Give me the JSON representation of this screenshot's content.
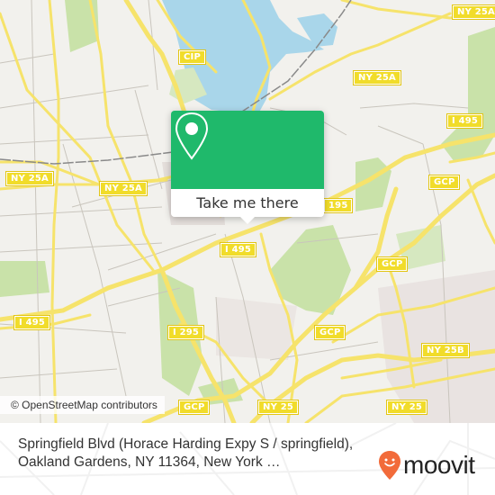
{
  "map": {
    "attribution": "© OpenStreetMap contributors",
    "colors": {
      "land": "#f2f1ed",
      "water": "#a9d6ea",
      "park": "#c9e2a9",
      "road_major": "#f6e36b",
      "road_minor": "#c9c5bd",
      "rail": "#8a8a8a",
      "shield_bg": "#f1dc2a"
    },
    "shields": [
      {
        "label": "NY 25A"
      },
      {
        "label": "CIP"
      },
      {
        "label": "NY 25A"
      },
      {
        "label": "NY 25A"
      },
      {
        "label": "NY 25A"
      },
      {
        "label": "I 495"
      },
      {
        "label": "GCP"
      },
      {
        "label": "I 495"
      },
      {
        "label": "I 495"
      },
      {
        "label": "I 295"
      },
      {
        "label": "GCP"
      },
      {
        "label": "GCP"
      },
      {
        "label": "NY 25B"
      },
      {
        "label": "GCP"
      },
      {
        "label": "NY 25"
      },
      {
        "label": "NY 25"
      },
      {
        "label": "195"
      }
    ]
  },
  "popup": {
    "icon": "map-pin-icon",
    "button_label": "Take me there",
    "color": "#1fb96b"
  },
  "footer": {
    "address": "Springfield Blvd (Horace Harding Expy S / springfield), Oakland Gardens, NY 11364, New York …",
    "logo": {
      "text": "moovit",
      "icon": "moovit-pin-icon",
      "color": "#f26b3a"
    }
  }
}
